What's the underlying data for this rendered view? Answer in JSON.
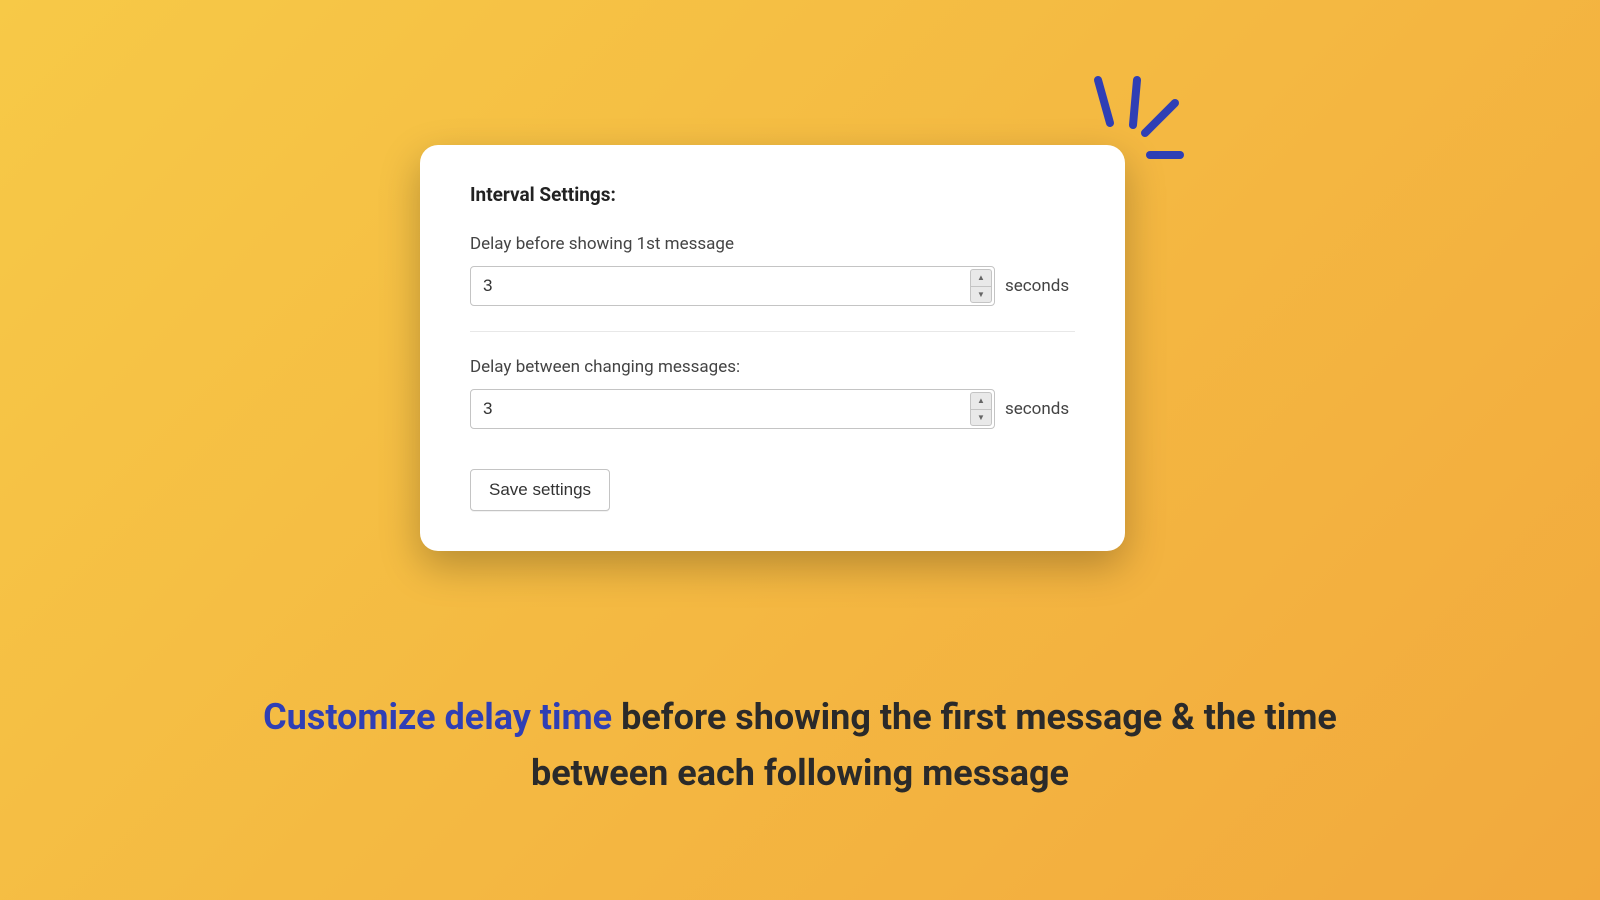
{
  "settings": {
    "title": "Interval Settings:",
    "field1": {
      "label": "Delay before showing 1st message",
      "value": "3",
      "unit": "seconds"
    },
    "field2": {
      "label": "Delay between changing messages:",
      "value": "3",
      "unit": "seconds"
    },
    "save_button_label": "Save settings"
  },
  "caption": {
    "highlight": "Customize delay time",
    "rest": " before showing the first message & the time between each following message"
  }
}
